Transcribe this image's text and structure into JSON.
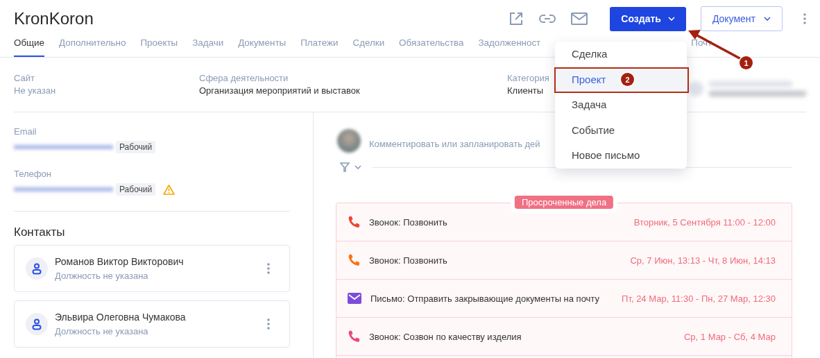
{
  "title": "KronKoron",
  "header_actions": {
    "create": "Создать",
    "document": "Документ"
  },
  "tabs": [
    {
      "label": "Общие",
      "selected": true
    },
    {
      "label": "Дополнительно",
      "selected": false
    },
    {
      "label": "Проекты",
      "selected": false
    },
    {
      "label": "Задачи",
      "selected": false
    },
    {
      "label": "Документы",
      "selected": false
    },
    {
      "label": "Платежи",
      "selected": false
    },
    {
      "label": "Сделки",
      "selected": false
    },
    {
      "label": "Обязательства",
      "selected": false
    },
    {
      "label": "Задолженност",
      "selected": false
    },
    {
      "label": "Почт",
      "selected": false
    }
  ],
  "info": [
    {
      "label": "Сайт",
      "value": "Не указан",
      "muted": true
    },
    {
      "label": "Сфера деятельности",
      "value": "Организация мероприятий и выставок",
      "muted": false
    },
    {
      "label": "Категория",
      "value": "Клиенты",
      "muted": false
    }
  ],
  "contact_info": [
    {
      "label": "Email",
      "tag": "Рабочий",
      "warning": false
    },
    {
      "label": "Телефон",
      "tag": "Рабочий",
      "warning": true
    }
  ],
  "contacts_title": "Контакты",
  "contacts": [
    {
      "name": "Романов Виктор Викторович",
      "role": "Должность не указана"
    },
    {
      "name": "Эльвира Олеговна Чумакова",
      "role": "Должность не указана"
    }
  ],
  "comment_placeholder": "Комментировать или запланировать дей",
  "overdue_title": "Просроченные дела",
  "activities": [
    {
      "kind": "call",
      "color": "#f04438",
      "title": "Звонок: Позвонить",
      "date": "Вторник, 5 Сентября 11:00 - 12:00"
    },
    {
      "kind": "call",
      "color": "#f97316",
      "title": "Звонок: Позвонить",
      "date": "Ср, 7 Июн, 13:13 - Чт, 8 Июн, 14:13"
    },
    {
      "kind": "mail",
      "color": "#7c4ddb",
      "title": "Письмо: Отправить закрывающие документы на почту",
      "date": "Пт, 24 Мар, 11:30 - Пн, 27 Мар, 12:30"
    },
    {
      "kind": "call",
      "color": "#e84a7f",
      "title": "Звонок: Созвон по качеству изделия",
      "date": "Ср, 1 Мар - Сб, 4 Мар"
    }
  ],
  "create_menu": [
    {
      "label": "Сделка",
      "selected": false
    },
    {
      "label": "Проект",
      "selected": true
    },
    {
      "label": "Задача",
      "selected": false
    },
    {
      "label": "Событие",
      "selected": false
    },
    {
      "label": "Новое письмо",
      "selected": false
    }
  ],
  "annotations": [
    {
      "label": "1"
    },
    {
      "label": "2"
    }
  ]
}
